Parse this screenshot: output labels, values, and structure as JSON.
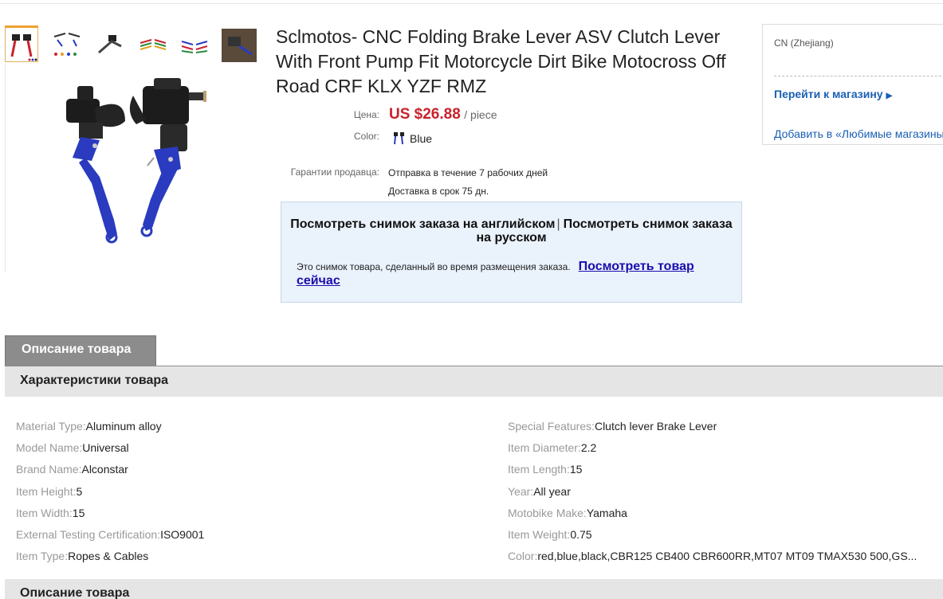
{
  "product": {
    "title": "Sclmotos- CNC Folding Brake Lever ASV Clutch Lever With Front Pump Fit Motorcycle Dirt Bike Motocross Off Road CRF KLX YZF RMZ",
    "price_label": "Цена:",
    "price": "US $26.88",
    "price_unit": "/ piece",
    "color_label": "Color:",
    "color_value": "Blue",
    "guarantee_label": "Гарантии продавца:",
    "guarantee_lines": [
      "Отправка в течение 7 рабочих дней",
      "Доставка в срок 75 дн."
    ],
    "thumbnail_count": 6,
    "accent_color": "#c9222c",
    "lever_color": "#2a3bbf"
  },
  "snapshot": {
    "view_english": "Посмотреть снимок заказа на английском",
    "separator": "|",
    "view_russian": "Посмотреть снимок заказа на русском",
    "note": "Это снимок товара, сделанный во время размещения заказа.",
    "view_now_link": "Посмотреть товар сейчас"
  },
  "store": {
    "origin": "CN (Zhejiang)",
    "go_to_store": "Перейти к магазину",
    "add_favorites": "Добавить в «Любимые магазины»"
  },
  "tabs": {
    "description_tab": "Описание товара"
  },
  "sections": {
    "specs_title": "Характеристики товара",
    "description_title": "Описание товара"
  },
  "specs_left": [
    {
      "key": "Material Type:",
      "value": "Aluminum alloy"
    },
    {
      "key": "Model Name:",
      "value": "Universal"
    },
    {
      "key": "Brand Name:",
      "value": "Alconstar"
    },
    {
      "key": "Item Height:",
      "value": "5"
    },
    {
      "key": "Item Width:",
      "value": "15"
    },
    {
      "key": "External Testing Certification:",
      "value": "ISO9001"
    },
    {
      "key": "Item Type:",
      "value": "Ropes & Cables"
    }
  ],
  "specs_right": [
    {
      "key": "Special Features:",
      "value": "Clutch lever Brake Lever"
    },
    {
      "key": "Item Diameter:",
      "value": "2.2"
    },
    {
      "key": "Item Length:",
      "value": "15"
    },
    {
      "key": "Year:",
      "value": "All year"
    },
    {
      "key": "Motobike Make:",
      "value": "Yamaha"
    },
    {
      "key": "Item Weight:",
      "value": "0.75"
    },
    {
      "key": "Color:",
      "value": "red,blue,black,CBR125 CB400 CBR600RR,MT07 MT09 TMAX530 500,GS..."
    }
  ]
}
